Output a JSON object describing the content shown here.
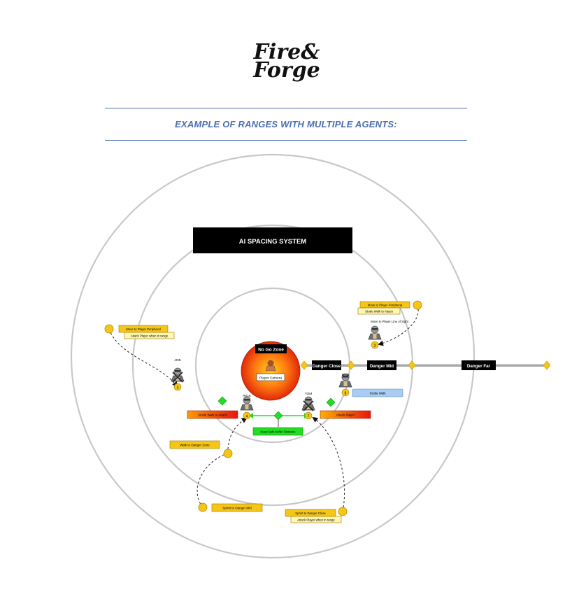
{
  "logo": {
    "line1": "Fire&",
    "line2": "Forge"
  },
  "heading": "EXAMPLE OF RANGES WITH MULTIPLE AGENTS:",
  "diagram": {
    "title": "AI SPACING SYSTEM",
    "no_go_zone": "No Go Zone",
    "player_camera": "Player Camera",
    "range_labels": {
      "close": "Danger Close",
      "mid": "Danger Mid",
      "far": "Danger Far"
    },
    "agents": {
      "joe": "JOE",
      "rick": "RICK",
      "tom": "TOM",
      "bob": "BOB",
      "far_agent": "MAX",
      "joe_num": "3",
      "rick_num": "4",
      "tom_num": "7",
      "bob_num": "8",
      "far_num": "2"
    },
    "labels": {
      "move_peripheral_left": "Move to Player Peripheral",
      "attack_in_range_left": "Attack Player when in range",
      "move_peripheral_right": "Move to Player Peripheral",
      "strafe_attack_right": "Strafe Walk to Attack",
      "move_line_of_sight": "Move to Player Line of Sight",
      "strafe_walk": "Strafe Walk",
      "strafe_walk_attack": "Strafe Walk to Attack",
      "attack_player": "Attack Player",
      "keep_safe_buffer": "Keep Safe buffer Distance",
      "walk_danger_zone": "Walk to Danger Zone",
      "sprint_danger_mid": "Sprint to Danger Mid",
      "sprint_danger_close": "Sprint to Danger Close",
      "attack_in_range_bottom": "Attack Player when in range"
    },
    "colors": {
      "yellow": "#f5c518",
      "yellow_light": "#fff6b0",
      "green": "#22dd22",
      "blue_light": "#a9cdf2",
      "black": "#000000",
      "ring": "#c8c8c8",
      "zone_center": "#ffd21a",
      "zone_edge": "#e02a0a",
      "heading_blue": "#4a6fb0"
    }
  }
}
